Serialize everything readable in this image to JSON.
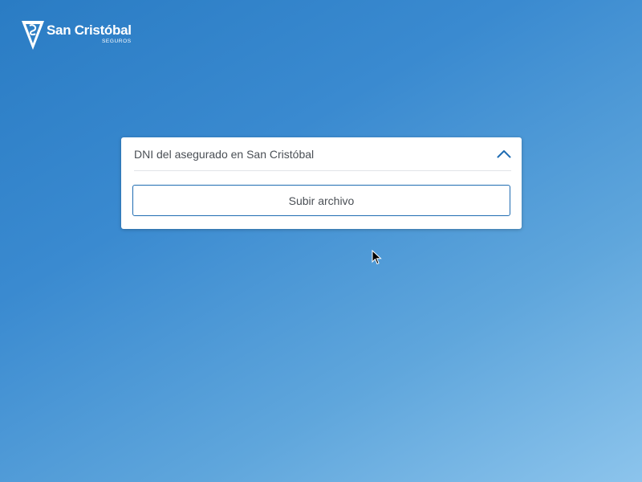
{
  "brand": {
    "name": "San Cristóbal",
    "subtitle": "SEGUROS"
  },
  "accordion": {
    "title": "DNI del asegurado en San Cristóbal",
    "expanded": true,
    "toggle_icon": "chevron-up-icon",
    "upload_label": "Subir archivo"
  },
  "colors": {
    "accent": "#1f6cb2",
    "background_start": "#2a7cc4",
    "background_end": "#8cc4ec"
  }
}
